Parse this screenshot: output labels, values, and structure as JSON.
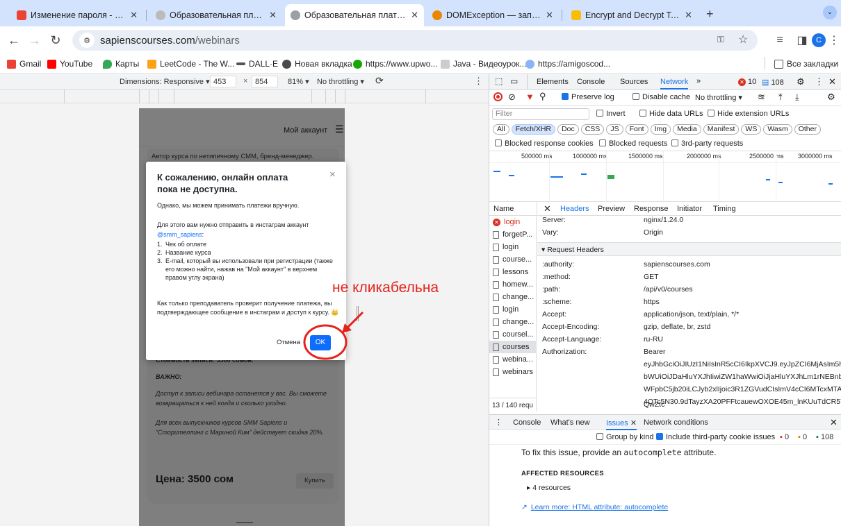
{
  "tabs": [
    {
      "label": "Изменение пароля - chynara",
      "fav_color": "#ea4335"
    },
    {
      "label": "Образовательная платформа",
      "fav_color": "#bbbbbb"
    },
    {
      "label": "Образовательная платформа",
      "fav_color": "#9aa0a6"
    },
    {
      "label": "DOMException — запрос play()",
      "fav_color": "#ea8600"
    },
    {
      "label": "Encrypt and Decrypt Text Online",
      "fav_color": "#fbbc04"
    }
  ],
  "toolbar": {
    "url_host": "sapienscourses.com",
    "url_path": "/webinars",
    "profile_letter": "C"
  },
  "bookmarks": [
    {
      "label": "Gmail",
      "color": "#ea4335"
    },
    {
      "label": "YouTube",
      "color": "#ff0000"
    },
    {
      "label": "Карты",
      "color": "#34a853"
    },
    {
      "label": "LeetCode - The W...",
      "color": "#ffa116"
    },
    {
      "label": "DALL·E",
      "color": "#555555"
    },
    {
      "label": "Новая вкладка",
      "color": "#4a4a4a"
    },
    {
      "label": "https://www.upwo...",
      "color": "#14a800"
    },
    {
      "label": "Java - Видеоурок...",
      "color": "#cccccc"
    },
    {
      "label": "https://amigoscod...",
      "color": "#8ab4f8"
    }
  ],
  "all_bookmarks_label": "Все закладки",
  "device_bar": {
    "dimensions": "Dimensions: Responsive ▾",
    "width": "453",
    "times": "×",
    "height": "854",
    "zoom": "81% ▾",
    "throttle": "No throttling ▾"
  },
  "page": {
    "header_account": "Мой аккаунт",
    "author_text": "Автор курса по нетипичному СММ, бренд-менеджер.",
    "cost_text": "Стоимость записи: 3500 сомов.",
    "important_label": "ВАЖНО:",
    "access_text": "Доступ к записи вебинара останется у вас. Вы сможете возвращаться к ней когда и сколько угодно.",
    "discount_text": "Для всех выпускников курсов SMM Sapiens и “Сторителлинг с Мариной Ким” действует скидка 20%.",
    "price": "Цена: 3500 сом",
    "buy_label": "Купить"
  },
  "modal": {
    "title": "К сожалению, онлайн оплата пока не доступна.",
    "p1": "Однако, мы можем принимать платежи вручную.",
    "p2": "Для этого вам нужно отправить в инстаграм аккаунт",
    "instagram": "@smm_sapiens",
    "colon": ":",
    "list": [
      "Чек об оплате",
      "Название курса",
      "E-mail, который вы использовали при регистрации (также его можно найти, нажав на \"Мой аккаунт\" в верхнем правом углу экрана)"
    ],
    "p3": "Как только преподаватель проверит получение платежа, вы подтверждающее сообщение в инстаграм и доступ к курсу. 👑",
    "cancel_label": "Отмена",
    "ok_label": "OK",
    "close": "×"
  },
  "annotation": {
    "text": "не кликабельна",
    "color": "#e5231d"
  },
  "devtools": {
    "tabs": [
      "Elements",
      "Console",
      "Sources",
      "Network",
      "»"
    ],
    "active_tab": "Network",
    "errors": "10",
    "messages": "108",
    "preserve_log": "Preserve log",
    "disable_cache": "Disable cache",
    "throttling": "No throttling",
    "filter_placeholder": "Filter",
    "invert": "Invert",
    "hide_data_urls": "Hide data URLs",
    "hide_ext_urls": "Hide extension URLs",
    "type_filters": [
      "All",
      "Fetch/XHR",
      "Doc",
      "CSS",
      "JS",
      "Font",
      "Img",
      "Media",
      "Manifest",
      "WS",
      "Wasm",
      "Other"
    ],
    "selected_filter": "Fetch/XHR",
    "blocked_cookies": "Blocked response cookies",
    "blocked_requests": "Blocked requests",
    "third_party": "3rd-party requests",
    "timeline_ticks": [
      "500000 ms",
      "1000000 ms",
      "1500000 ms",
      "2000000 ms",
      "2500000 ms",
      "3000000 ms"
    ],
    "name_header": "Name",
    "detail_tabs": [
      "Headers",
      "Preview",
      "Response",
      "Initiator",
      "Timing"
    ],
    "active_detail": "Headers",
    "requests": [
      {
        "name": "login",
        "error": true
      },
      {
        "name": "forgetP...",
        "error": false
      },
      {
        "name": "login",
        "error": false
      },
      {
        "name": "course...",
        "error": false
      },
      {
        "name": "lessons",
        "error": false
      },
      {
        "name": "homew...",
        "error": false
      },
      {
        "name": "change...",
        "error": false
      },
      {
        "name": "login",
        "error": false
      },
      {
        "name": "change...",
        "error": false
      },
      {
        "name": "coursel...",
        "error": false
      },
      {
        "name": "courses",
        "error": false,
        "selected": true
      },
      {
        "name": "webina...",
        "error": false
      },
      {
        "name": "webinars",
        "error": false
      }
    ],
    "req_count": "13 / 140 requ",
    "response_headers": [
      {
        "k": "Server:",
        "v": "nginx/1.24.0"
      },
      {
        "k": "Vary:",
        "v": "Origin"
      }
    ],
    "request_headers_title": "▾ Request Headers",
    "request_headers": [
      {
        "k": ":authority:",
        "v": "sapienscourses.com"
      },
      {
        "k": ":method:",
        "v": "GET"
      },
      {
        "k": ":path:",
        "v": "/api/v0/courses"
      },
      {
        "k": ":scheme:",
        "v": "https"
      },
      {
        "k": "Accept:",
        "v": "application/json, text/plain, */*"
      },
      {
        "k": "Accept-Encoding:",
        "v": "gzip, deflate, br, zstd"
      },
      {
        "k": "Accept-Language:",
        "v": "ru-RU"
      },
      {
        "k": "Authorization:",
        "v": "Bearer"
      }
    ],
    "auth_lines": [
      "eyJhbGciOiJIUzI1NiIsInR5cCI6IkpXVCJ9.eyJpZCI6MjAsIm5h",
      "bWUiOiJDaHluYXJhIiwiZW1haWwiOiJjaHluYXJhLm1rNEBnb",
      "WFpbC5jb20iLCJyb2xlIjoic3R1ZGVudCIsImV4cCI6MTcxMTA",
      "4OTc5N30.9dTayzXA20PFFtcauewOXOE45m_lnKUuTdCR57",
      "QwZtc"
    ],
    "drawer_tabs": [
      "Console",
      "What's new",
      "Issues",
      "Network conditions"
    ],
    "active_drawer": "Issues",
    "group_by_kind": "Group by kind",
    "include_third": "Include third-party cookie issues",
    "issue_counts": [
      "0",
      "0",
      "108"
    ],
    "issue_text_pre": "To fix this issue, provide an",
    "issue_code": "autocomplete",
    "issue_text_post": "attribute.",
    "affected": "AFFECTED RESOURCES",
    "resources": "▸ 4 resources",
    "learn_more": "Learn more: HTML attribute: autocomplete"
  }
}
